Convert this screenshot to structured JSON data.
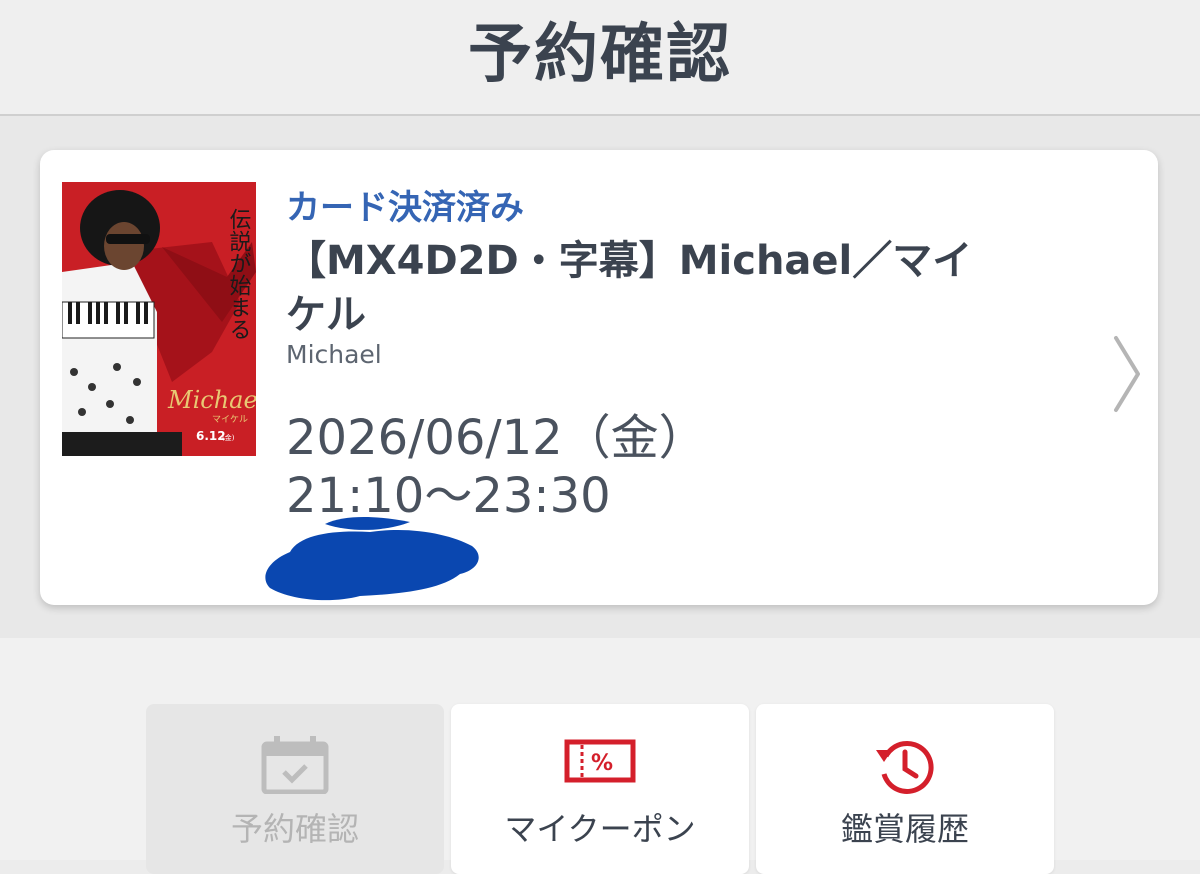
{
  "header": {
    "title": "予約確認"
  },
  "reservation": {
    "payment_status": "カード決済済み",
    "title": "【MX4D2D・字幕】Michael／マイケル",
    "subtitle": "Michael",
    "date": "2026/06/12（金）",
    "time": "21:10〜23:30",
    "poster": {
      "tagline": "伝説が始まる",
      "logo": "Michael",
      "logo_ja": "マイケル",
      "release": "6.12",
      "release_suffix": "(金)"
    }
  },
  "tabs": [
    {
      "label": "予約確認",
      "icon": "calendar-check-icon",
      "active": true
    },
    {
      "label": "マイクーポン",
      "icon": "coupon-icon",
      "active": false
    },
    {
      "label": "鑑賞履歴",
      "icon": "history-clock-icon",
      "active": false
    }
  ],
  "colors": {
    "accent_blue": "#3565b4",
    "icon_red": "#d41f2b",
    "redaction": "#0a47b0",
    "poster_red": "#c91f25"
  }
}
